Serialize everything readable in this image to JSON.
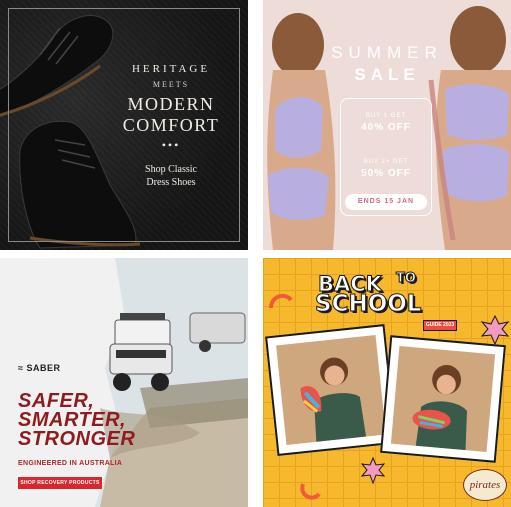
{
  "tile1": {
    "heritage": "HERITAGE",
    "meets": "MEETS",
    "line1": "MODERN",
    "line2": "COMFORT",
    "dots": "•••",
    "cta_line1": "Shop Classic",
    "cta_line2": "Dress Shoes"
  },
  "tile2": {
    "summer": "SUMMER",
    "sale": "SALE",
    "offer1_label": "BUY 1 GET",
    "offer1_value": "40% OFF",
    "offer2_label": "BUY 2+ GET",
    "offer2_value": "50% OFF",
    "ends": "ENDS 15 JAN"
  },
  "tile3": {
    "logo": "SABER",
    "headline1": "SAFER,",
    "headline2": "SMARTER,",
    "headline3": "STRONGER",
    "tagline": "ENGINEERED IN AUSTRALIA",
    "button": "SHOP RECOVERY PRODUCTS"
  },
  "tile4": {
    "back": "BACK",
    "to": "TO",
    "school": "SCHOOL",
    "guide": "GUIDE 2023",
    "brand": "pirates"
  },
  "colors": {
    "shoe_bg": "#1c1c1c",
    "summer_bg": "#eddcd8",
    "saber_red": "#8e1c1f",
    "school_yellow": "#f6b82c"
  }
}
